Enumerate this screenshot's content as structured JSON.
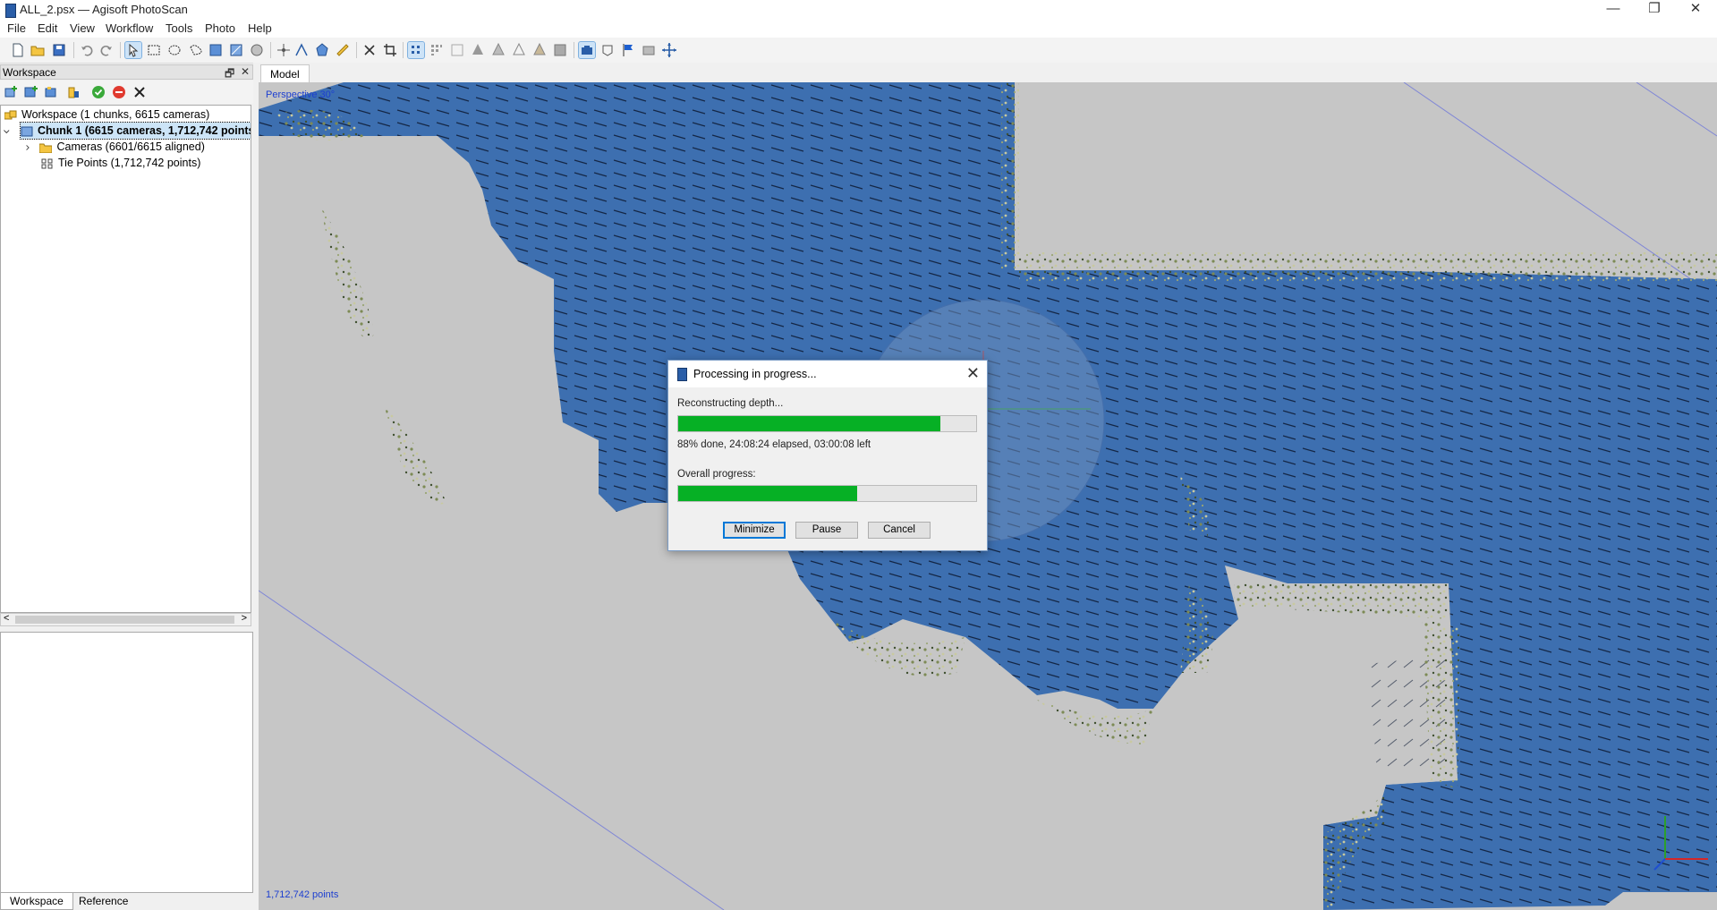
{
  "window": {
    "title": "ALL_2.psx — Agisoft PhotoScan",
    "minimize_glyph": "—",
    "restore_glyph": "❐",
    "close_glyph": "✕"
  },
  "menu": [
    "File",
    "Edit",
    "View",
    "Workflow",
    "Tools",
    "Photo",
    "Help"
  ],
  "toolbar_icons": [
    "new-icon",
    "open-icon",
    "save-icon",
    "undo-icon",
    "redo-icon",
    "navigation-icon",
    "rectangle-selection-icon",
    "circle-selection-icon",
    "free-form-selection-icon",
    "select-icon",
    "resize-region-icon",
    "rotate-region-icon",
    "rotate-object-icon",
    "move-object-icon",
    "draw-point-icon",
    "draw-polyline-icon",
    "draw-polygon-icon",
    "ruler-icon",
    "delete-selection-icon",
    "crop-icon",
    "point-cloud-icon",
    "dense-cloud-icon",
    "dense-cloud-classes-icon",
    "solid-model-icon",
    "shaded-model-icon",
    "wireframe-model-icon",
    "textured-model-icon",
    "tiled-model-icon",
    "show-cameras-icon",
    "show-thumbnails-icon",
    "show-markers-icon",
    "show-region-icon",
    "show-trackball-icon"
  ],
  "workspace": {
    "header": "Workspace",
    "float_glyph": "🗗",
    "close_glyph": "✕",
    "tree": {
      "root": "Workspace (1 chunks, 6615 cameras)",
      "chunk": "Chunk 1 (6615 cameras, 1,712,742 points)",
      "cameras": "Cameras (6601/6615 aligned)",
      "tie_points": "Tie Points (1,712,742 points)"
    },
    "scroll_left": "<",
    "scroll_right": ">",
    "bottom_tabs": [
      "Workspace",
      "Reference"
    ],
    "active_tab": "Workspace"
  },
  "model": {
    "tab": "Model",
    "perspective_label": "Perspective 30°",
    "points_label": "1,712,742 points"
  },
  "dialog": {
    "title": "Processing in progress...",
    "close_glyph": "✕",
    "stage_label": "Reconstructing depth...",
    "stage_progress": 0.88,
    "stage_status": "88% done, 24:08:24 elapsed, 03:00:08 left",
    "overall_label": "Overall progress:",
    "overall_progress": 0.6,
    "buttons": {
      "minimize": "Minimize",
      "pause": "Pause",
      "cancel": "Cancel"
    }
  },
  "colors": {
    "cloud_blue": "#3d6fb0",
    "background_gray": "#c6c6c6",
    "progress_green": "#06b025",
    "accent_blue": "#0078d7"
  }
}
